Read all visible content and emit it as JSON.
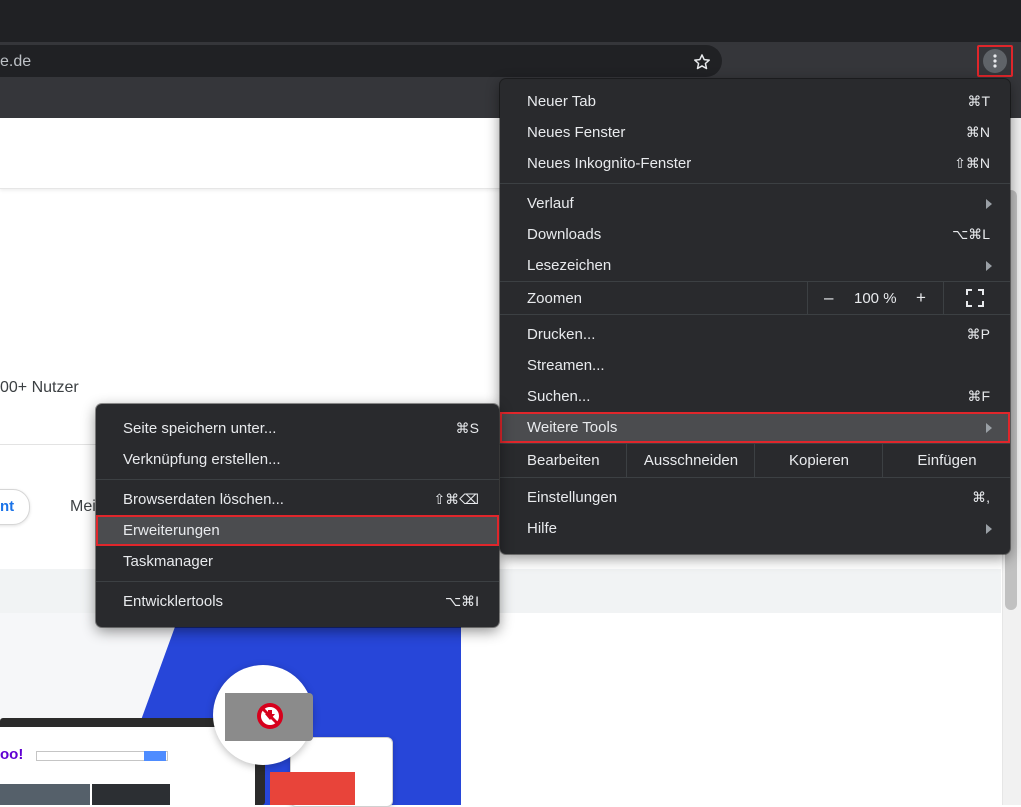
{
  "omnibox": {
    "url_fragment": "e.de"
  },
  "page": {
    "users_text": "00+ Nutzer",
    "pill_text": "nt",
    "mei_text": "Mei"
  },
  "hero": {
    "yahoo": "oo!"
  },
  "main_menu": {
    "new_tab": {
      "label": "Neuer Tab",
      "shortcut": "⌘T"
    },
    "new_window": {
      "label": "Neues Fenster",
      "shortcut": "⌘N"
    },
    "new_incognito": {
      "label": "Neues Inkognito-Fenster",
      "shortcut": "⇧⌘N"
    },
    "history": {
      "label": "Verlauf"
    },
    "downloads": {
      "label": "Downloads",
      "shortcut": "⌥⌘L"
    },
    "bookmarks": {
      "label": "Lesezeichen"
    },
    "zoom": {
      "label": "Zoomen",
      "minus": "–",
      "value": "100 %",
      "plus": "+"
    },
    "print": {
      "label": "Drucken...",
      "shortcut": "⌘P"
    },
    "cast": {
      "label": "Streamen..."
    },
    "find": {
      "label": "Suchen...",
      "shortcut": "⌘F"
    },
    "more_tools": {
      "label": "Weitere Tools"
    },
    "edit": {
      "label": "Bearbeiten",
      "cut": "Ausschneiden",
      "copy": "Kopieren",
      "paste": "Einfügen"
    },
    "settings": {
      "label": "Einstellungen",
      "shortcut": "⌘,"
    },
    "help": {
      "label": "Hilfe"
    }
  },
  "sub_menu": {
    "save_page": {
      "label": "Seite speichern unter...",
      "shortcut": "⌘S"
    },
    "create_shortcut": {
      "label": "Verknüpfung erstellen..."
    },
    "clear_data": {
      "label": "Browserdaten löschen...",
      "shortcut": "⇧⌘⌫"
    },
    "extensions": {
      "label": "Erweiterungen"
    },
    "task_manager": {
      "label": "Taskmanager"
    },
    "dev_tools": {
      "label": "Entwicklertools",
      "shortcut": "⌥⌘I"
    }
  },
  "colors": {
    "menu_bg": "#292a2d",
    "highlight": "#4b4c4f",
    "annotation_red": "#e0262b",
    "chrome_dark": "#202124"
  },
  "icons": [
    "star-icon",
    "kebab-menu-icon",
    "submenu-arrow-icon",
    "fullscreen-icon",
    "adblock-icon"
  ]
}
